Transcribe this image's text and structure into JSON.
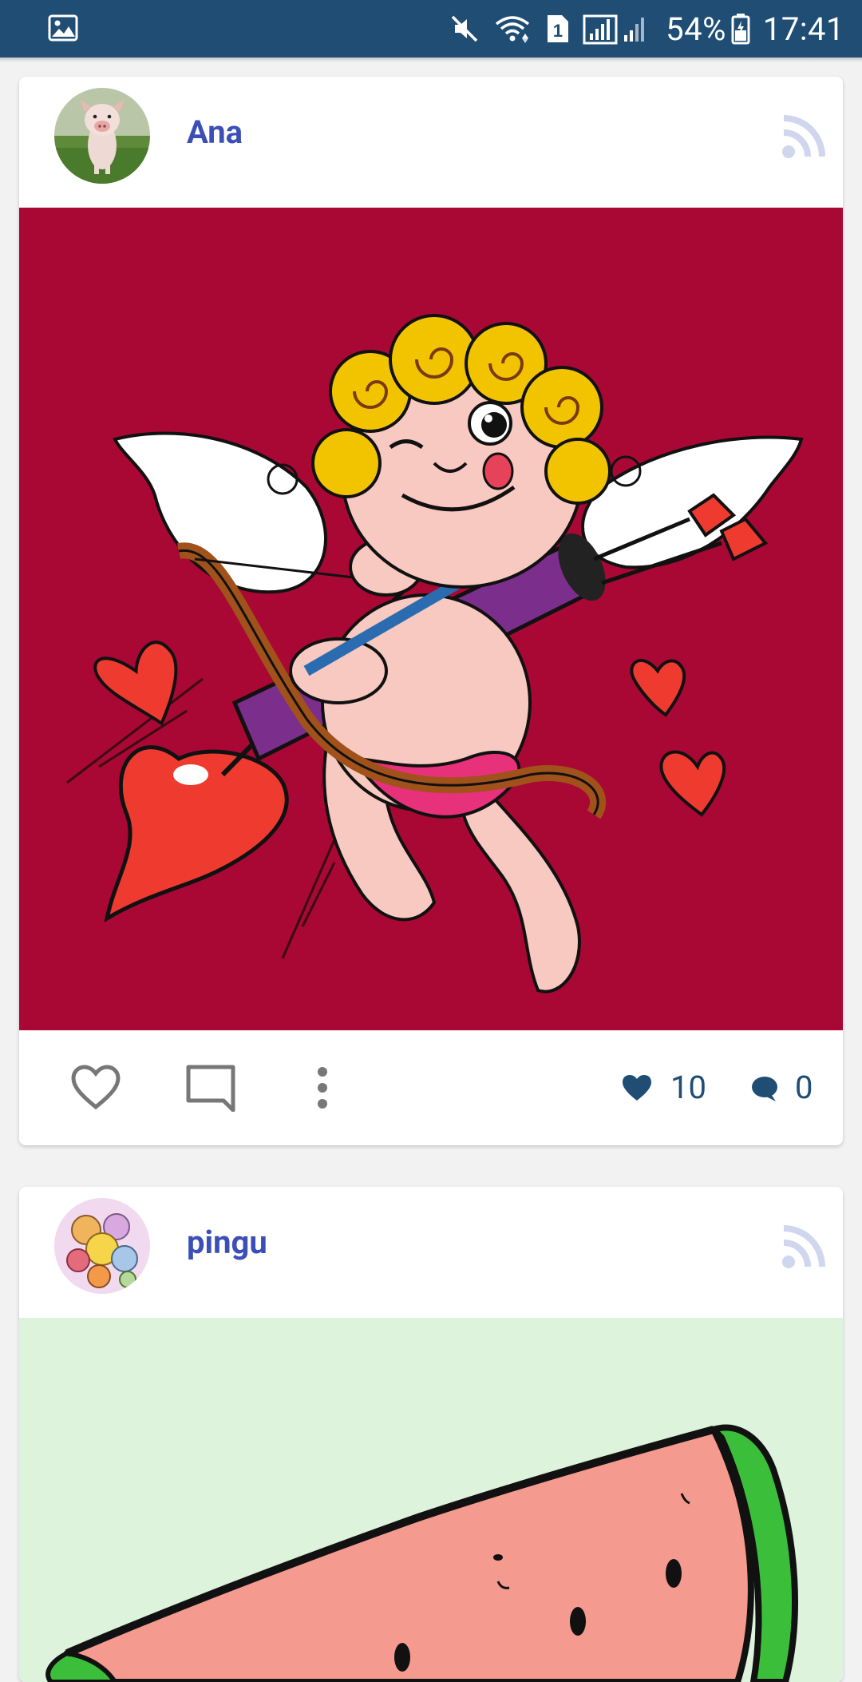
{
  "status_bar": {
    "battery": "54%",
    "time": "17:41",
    "sim_badge": "1",
    "icons": [
      "gallery-icon",
      "mute-icon",
      "wifi-icon",
      "sim-icon",
      "signal-icon",
      "battery-icon"
    ]
  },
  "posts": [
    {
      "user": "Ana",
      "avatar": "pig-avatar",
      "image": "cupid-coloring",
      "likes": "10",
      "comments": "0"
    },
    {
      "user": "pingu",
      "avatar": "animals-avatar",
      "image": "watermelon-coloring"
    }
  ],
  "colors": {
    "status_bar": "#1f4d73",
    "username": "#3b4fb6",
    "counts": "#1f4d73",
    "cupid_bg": "#a80833",
    "watermelon_bg": "#def3dc",
    "page_bg": "#f2f2f2"
  },
  "actions": [
    "heart-outline-icon",
    "comment-icon",
    "more-vert-icon",
    "heart-filled-icon",
    "comment-bubble-icon",
    "rss-feed-icon"
  ]
}
